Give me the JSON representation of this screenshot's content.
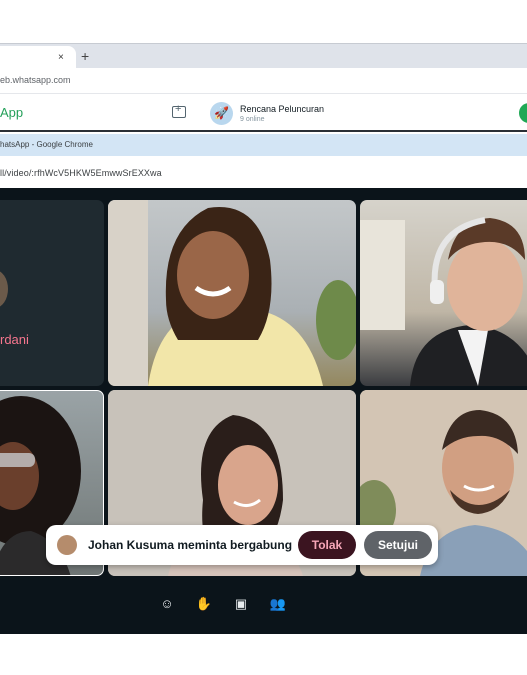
{
  "browser": {
    "tab_close": "×",
    "tab_new": "+",
    "url": "eb.whatsapp.com"
  },
  "whatsapp": {
    "brand": "App",
    "chat_avatar_emoji": "🚀",
    "chat_name": "Rencana Peluncuran",
    "chat_status": "9 online"
  },
  "popup": {
    "title": "hatsApp - Google Chrome",
    "url": "ll/video/:rfhWcV5HKW5EmwwSrEXXwa"
  },
  "call": {
    "participant_name": "rdani",
    "request": {
      "text": "Johan Kusuma meminta bergabung",
      "decline_label": "Tolak",
      "accept_label": "Setujui"
    },
    "controls": [
      {
        "icon": "emoji-icon",
        "glyph": "☺"
      },
      {
        "icon": "raise-hand-icon",
        "glyph": "✋"
      },
      {
        "icon": "screen-share-icon",
        "glyph": "▣"
      },
      {
        "icon": "participants-icon",
        "glyph": "👥"
      }
    ]
  },
  "colors": {
    "whatsapp_green": "#25a05a",
    "call_background": "#0b141a",
    "decline_bg": "#3b1420",
    "accept_bg": "#5f6368",
    "participant_name": "#f7768e"
  }
}
